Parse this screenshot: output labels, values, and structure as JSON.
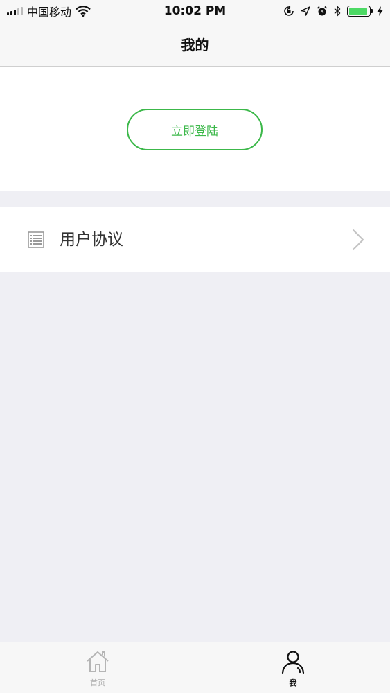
{
  "status_bar": {
    "carrier": "中国移动",
    "time": "10:02 PM",
    "icons": [
      "signal-icon",
      "wifi-icon",
      "orientation-lock-icon",
      "location-arrow-icon",
      "alarm-icon",
      "bluetooth-icon",
      "battery-icon",
      "charging-bolt-icon"
    ],
    "battery_level": 0.9,
    "battery_color": "#4cd964"
  },
  "nav": {
    "title": "我的"
  },
  "login": {
    "button_label": "立即登陆",
    "accent_color": "#3cb84a"
  },
  "menu": {
    "items": [
      {
        "icon": "document-list-icon",
        "label": "用户协议",
        "trailing_icon": "chevron-right-icon"
      }
    ]
  },
  "tab_bar": {
    "tabs": [
      {
        "icon": "home-icon",
        "label": "首页",
        "active": false
      },
      {
        "icon": "user-icon",
        "label": "我",
        "active": true
      }
    ]
  }
}
